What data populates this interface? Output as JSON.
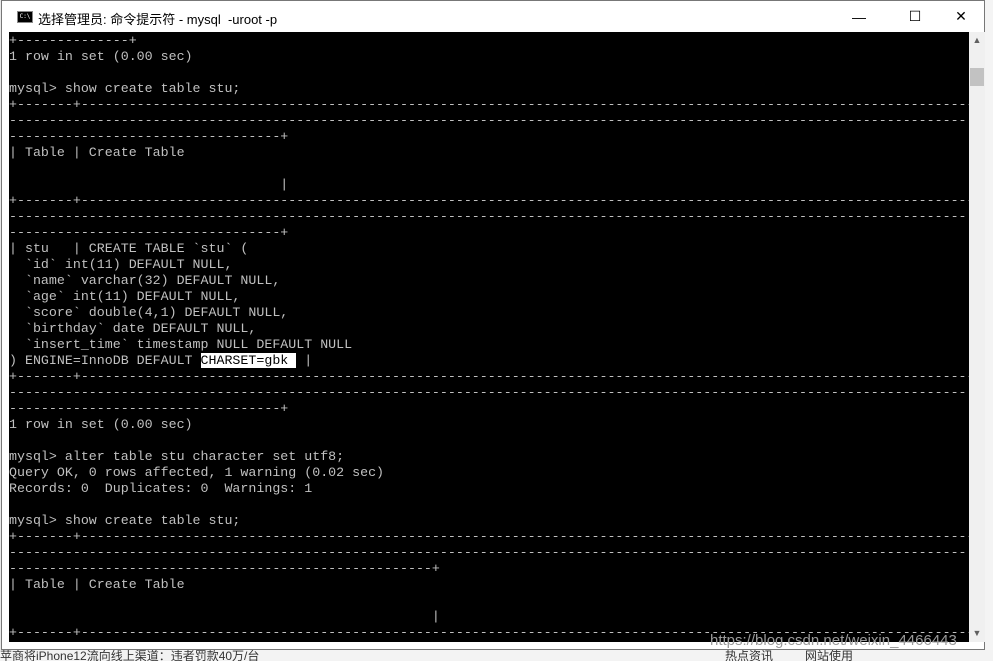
{
  "window": {
    "title": "选择管理员: 命令提示符 - mysql  -uroot -p",
    "icon": "cmd-icon",
    "minimize": "—",
    "maximize": "☐",
    "close": "✕"
  },
  "console": {
    "lines": [
      "+--------------+",
      "1 row in set (0.00 sec)",
      "",
      "mysql> show create table stu;",
      "+-------+----------------------------------------------------------------------------------------------------------------",
      "------------------------------------------------------------------------------------------------------------------------",
      "----------------------------------+",
      "| Table | Create Table",
      "",
      "                                  |",
      "+-------+----------------------------------------------------------------------------------------------------------------",
      "------------------------------------------------------------------------------------------------------------------------",
      "----------------------------------+",
      "| stu   | CREATE TABLE `stu` (",
      "  `id` int(11) DEFAULT NULL,",
      "  `name` varchar(32) DEFAULT NULL,",
      "  `age` int(11) DEFAULT NULL,",
      "  `score` double(4,1) DEFAULT NULL,",
      "  `birthday` date DEFAULT NULL,",
      "  `insert_time` timestamp NULL DEFAULT NULL",
      ") ENGINE=InnoDB DEFAULT ",
      "+-------+----------------------------------------------------------------------------------------------------------------",
      "------------------------------------------------------------------------------------------------------------------------",
      "----------------------------------+",
      "1 row in set (0.00 sec)",
      "",
      "mysql> alter table stu character set utf8;",
      "Query OK, 0 rows affected, 1 warning (0.02 sec)",
      "Records: 0  Duplicates: 0  Warnings: 1",
      "",
      "mysql> show create table stu;",
      "+-------+----------------------------------------------------------------------------------------------------------------",
      "------------------------------------------------------------------------------------------------------------------------",
      "-----------------------------------------------------+",
      "| Table | Create Table",
      "",
      "                                                     |",
      "+-------+----------------------------------------------------------------------------------------------------------------"
    ],
    "highlighted": "CHARSET=gbk ",
    "after_highlight": " |"
  },
  "watermark": "https://blog.csdn.net/weixin_4466443",
  "taskbar": {
    "left_text": "苹商将iPhone12流向线上渠道：违者罚款40万/台",
    "item1": "热点资讯",
    "item2": "网站使用"
  }
}
